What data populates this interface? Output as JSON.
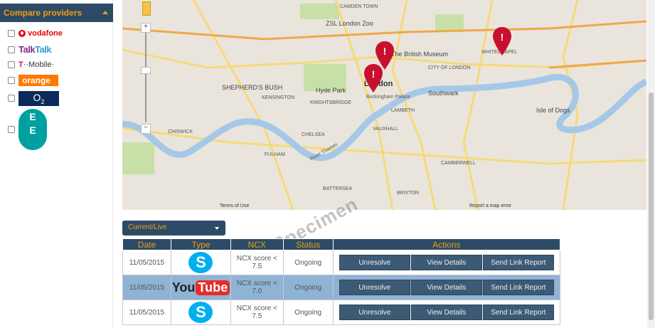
{
  "sidebar": {
    "header": "Compare providers",
    "providers": [
      {
        "name": "vodafone",
        "label": "vodafone"
      },
      {
        "name": "talktalk",
        "label_a": "Talk",
        "label_b": "Talk"
      },
      {
        "name": "t-mobile",
        "label_a": "T",
        "label_b": "··Mobile·"
      },
      {
        "name": "orange",
        "label": "orange"
      },
      {
        "name": "o2",
        "label": "O",
        "sub": "2"
      },
      {
        "name": "ee",
        "label_a": "E",
        "label_b": "E"
      }
    ]
  },
  "map": {
    "labels": {
      "london": "London",
      "shepherds_bush": "SHEPHERD'S BUSH",
      "southwark": "Southwark",
      "isle_of_dogs": "Isle of Dogs",
      "camden": "CAMDEN TOWN",
      "zsl": "ZSL London Zoo",
      "british_museum": "The British Museum",
      "city": "CITY OF LONDON",
      "hyde_park": "Hyde Park",
      "buckingham": "Buckingham Palace",
      "kensington": "KENSINGTON",
      "knightsbridge": "KNIGHTSBRIDGE",
      "chelsea": "CHELSEA",
      "fulham": "FULHAM",
      "battersea": "BATTERSEA",
      "brixton": "BRIXTON",
      "lambeth": "LAMBETH",
      "vauxhall": "VAUXHALL",
      "whitechapel": "WHITECHAPEL",
      "chiswick": "CHISWICK",
      "camberwell": "CAMBERWELL",
      "river": "River Thames"
    },
    "terms": "Terms of Use",
    "report": "Report a map error"
  },
  "watermark": "Specimen",
  "filter": {
    "selected": "Current/Live"
  },
  "table": {
    "headers": [
      "Date",
      "Type",
      "NCX",
      "Status",
      "Actions"
    ],
    "rows": [
      {
        "date": "11/05/2015",
        "type": "skype",
        "ncx": "NCX score < 7.5",
        "status": "Ongoing"
      },
      {
        "date": "11/05/2015",
        "type": "youtube",
        "ncx": "NCX score < 7.0",
        "status": "Ongoing"
      },
      {
        "date": "11/05/2015",
        "type": "skype",
        "ncx": "NCX score < 7.5",
        "status": "Ongoing"
      }
    ],
    "actions": {
      "unresolve": "Unresolve",
      "details": "View Details",
      "send": "Send Link Report"
    },
    "skype_glyph": "S",
    "youtube_a": "You",
    "youtube_b": "Tube"
  },
  "colors": {
    "navy": "#2d4b66",
    "accent": "#f39c12",
    "alt_row": "#8fb3d4",
    "pin": "#c8102e"
  }
}
